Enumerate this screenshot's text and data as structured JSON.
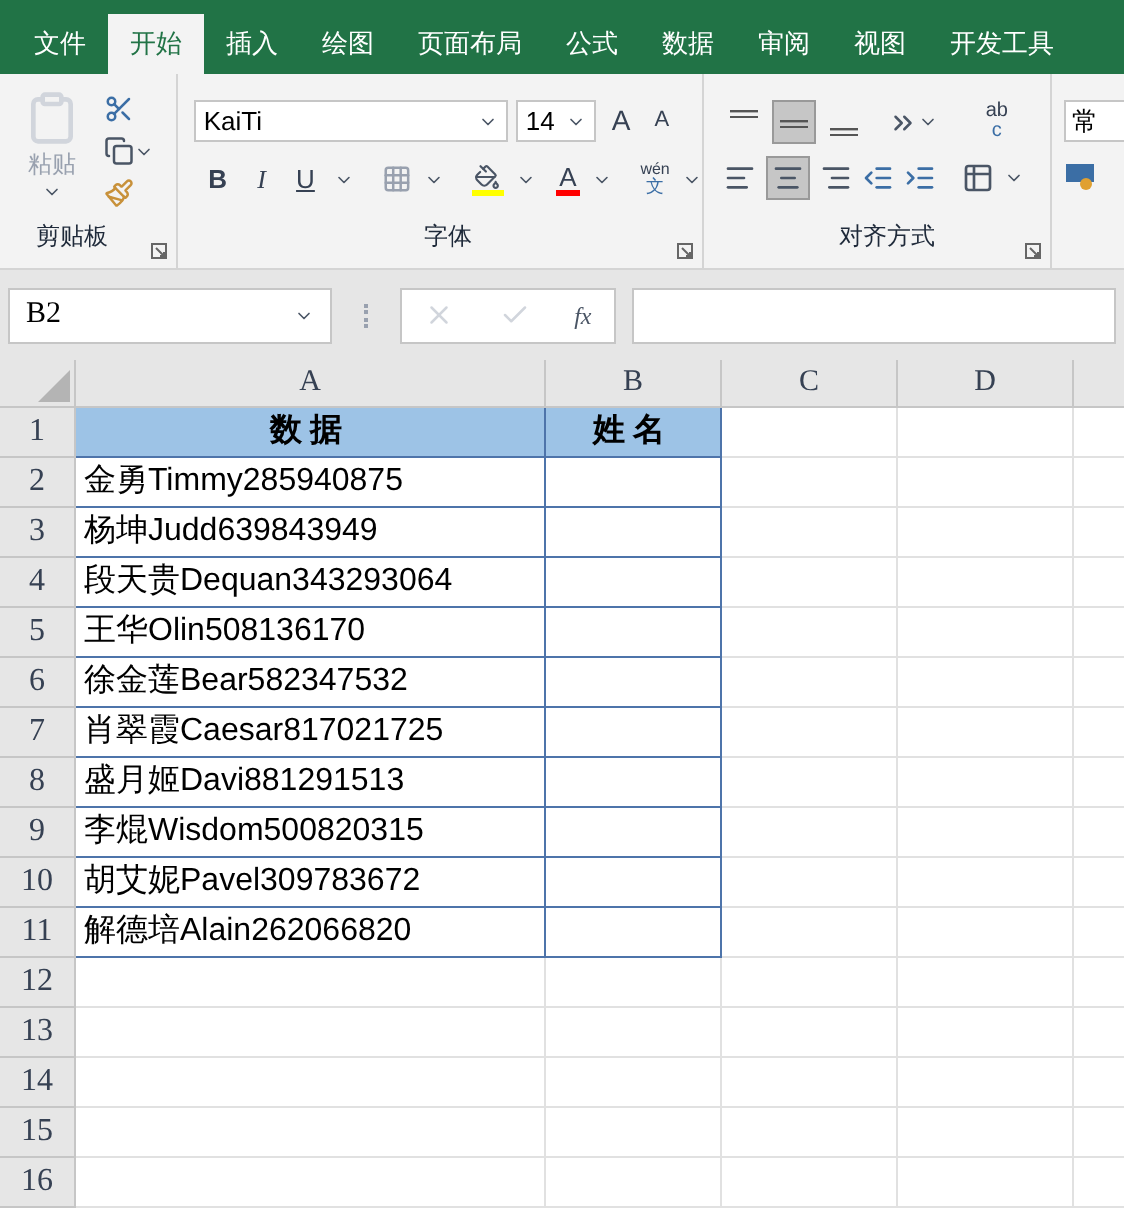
{
  "tabs": [
    {
      "label": "文件",
      "selected": false
    },
    {
      "label": "开始",
      "selected": true
    },
    {
      "label": "插入",
      "selected": false
    },
    {
      "label": "绘图",
      "selected": false
    },
    {
      "label": "页面布局",
      "selected": false
    },
    {
      "label": "公式",
      "selected": false
    },
    {
      "label": "数据",
      "selected": false
    },
    {
      "label": "审阅",
      "selected": false
    },
    {
      "label": "视图",
      "selected": false
    },
    {
      "label": "开发工具",
      "selected": false
    }
  ],
  "ribbon": {
    "paste_label": "粘贴",
    "font_name": "KaiTi",
    "font_size": "14",
    "grow_font": "A",
    "shrink_font": "A",
    "bold": "B",
    "italic": "I",
    "underline": "U",
    "font_color_letter": "A",
    "phonetic_top": "wén",
    "phonetic_bottom": "文",
    "wrap_top": "ab",
    "wrap_bottom": "c",
    "number_format": "常",
    "groups": [
      "剪贴板",
      "字体",
      "对齐方式"
    ]
  },
  "formula_bar": {
    "name_box": "B2",
    "fx": "fx"
  },
  "columns": [
    "A",
    "B",
    "C",
    "D"
  ],
  "rows": [
    {
      "number": "1",
      "cells": [
        "数据",
        "姓名"
      ]
    },
    {
      "number": "2",
      "cells": [
        "金勇Timmy285940875",
        ""
      ]
    },
    {
      "number": "3",
      "cells": [
        "杨坤Judd639843949",
        ""
      ]
    },
    {
      "number": "4",
      "cells": [
        "段天贵Dequan343293064",
        ""
      ]
    },
    {
      "number": "5",
      "cells": [
        "王华Olin508136170",
        ""
      ]
    },
    {
      "number": "6",
      "cells": [
        "徐金莲Bear582347532",
        ""
      ]
    },
    {
      "number": "7",
      "cells": [
        "肖翠霞Caesar817021725",
        ""
      ]
    },
    {
      "number": "8",
      "cells": [
        "盛月姬Davi881291513",
        ""
      ]
    },
    {
      "number": "9",
      "cells": [
        "李焜Wisdom500820315",
        ""
      ]
    },
    {
      "number": "10",
      "cells": [
        "胡艾妮Pavel309783672",
        ""
      ]
    },
    {
      "number": "11",
      "cells": [
        "解德培Alain262066820",
        ""
      ]
    },
    {
      "number": "12",
      "cells": []
    },
    {
      "number": "13",
      "cells": []
    },
    {
      "number": "14",
      "cells": []
    },
    {
      "number": "15",
      "cells": []
    },
    {
      "number": "16",
      "cells": []
    }
  ]
}
